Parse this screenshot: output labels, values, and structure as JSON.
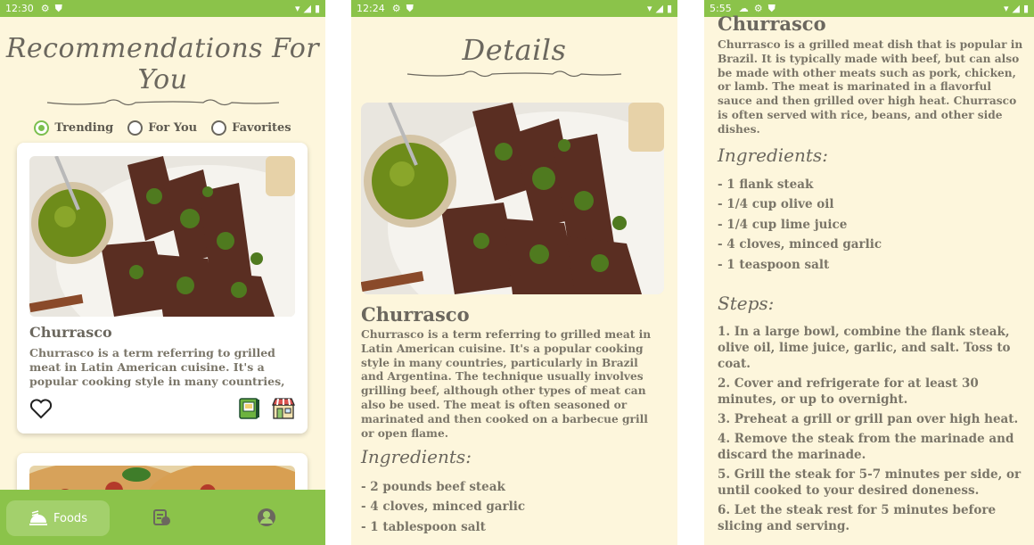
{
  "screen1": {
    "status_time": "12:30",
    "title": "Recommendations For You",
    "radios": [
      {
        "label": "Trending",
        "selected": true
      },
      {
        "label": "For You",
        "selected": false
      },
      {
        "label": "Favorites",
        "selected": false
      }
    ],
    "card": {
      "title": "Churrasco",
      "description": "Churrasco is a term referring to grilled meat in Latin American cuisine. It's a popular cooking style in many countries, particularl..."
    },
    "nav": {
      "active_label": "Foods"
    }
  },
  "screen2": {
    "status_time": "12:24",
    "title": "Details",
    "dish": "Churrasco",
    "description": "Churrasco is a term referring to grilled meat in Latin American cuisine. It's a popular cooking style in many countries, particularly in Brazil and Argentina. The technique usually involves grilling beef, although other types of meat can also be used. The meat is often seasoned or marinated and then cooked on a barbecue grill or open flame.",
    "ingredients_title": "Ingredients:",
    "ingredients": [
      "- 2 pounds beef steak",
      "- 4 cloves, minced garlic",
      "- 1 tablespoon salt"
    ]
  },
  "screen3": {
    "status_time": "5:55",
    "dish": "Churrasco",
    "description": "Churrasco is a grilled meat dish that is popular in Brazil. It is typically made with beef, but can also be made with other meats such as pork, chicken, or lamb. The meat is marinated in a flavorful sauce and then grilled over high heat. Churrasco is often served with rice, beans, and other side dishes.",
    "ingredients_title": "Ingredients:",
    "ingredients": [
      "- 1 flank steak",
      "- 1/4 cup olive oil",
      "- 1/4 cup lime juice",
      "- 4 cloves, minced garlic",
      "- 1 teaspoon salt"
    ],
    "steps_title": "Steps:",
    "steps": [
      "1. In a large bowl, combine the flank steak, olive oil, lime juice, garlic, and salt. Toss to coat.",
      "2. Cover and refrigerate for at least 30 minutes, or up to overnight.",
      "3. Preheat a grill or grill pan over high heat.",
      "4. Remove the steak from the marinade and discard the marinade.",
      "5. Grill the steak for 5-7 minutes per side, or until cooked to your desired doneness.",
      "6. Let the steak rest for 5 minutes before slicing and serving."
    ]
  },
  "colors": {
    "accent": "#8bc34a",
    "background": "#fdf6dc",
    "text": "#6b675e"
  }
}
